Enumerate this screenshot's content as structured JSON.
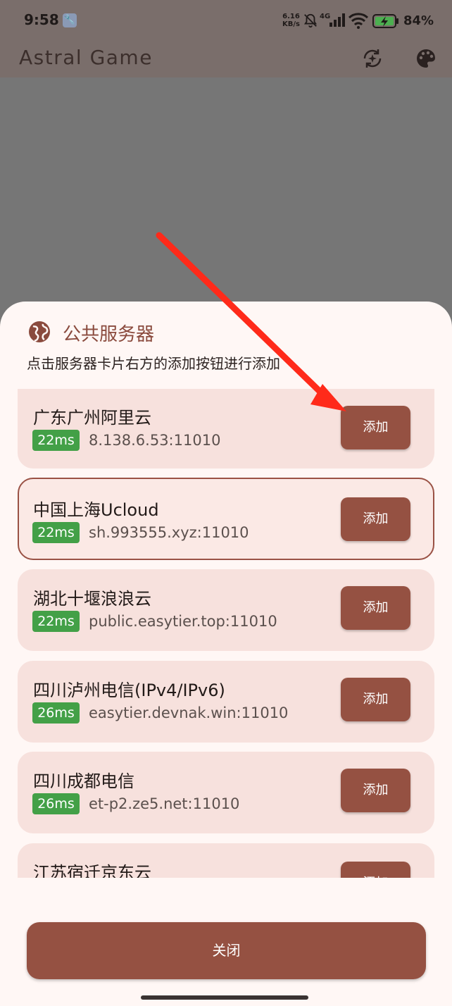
{
  "status_bar": {
    "time": "9:58",
    "net_speed_value": "6.16",
    "net_speed_unit": "KB/s",
    "battery": "84%",
    "icons": [
      "wrench-icon",
      "bell-off-icon",
      "signal-4g-icon",
      "wifi-icon",
      "battery-charging-icon"
    ]
  },
  "app_bar": {
    "title": "Astral Game",
    "icons": [
      "sync-sparkle-icon",
      "palette-icon"
    ]
  },
  "sheet": {
    "title": "公共服务器",
    "subtitle": "点击服务器卡片右方的添加按钮进行添加",
    "header_icon": "globe-icon",
    "servers": [
      {
        "name": "广东广州阿里云",
        "latency": "22ms",
        "address": "8.138.6.53:11010",
        "add_label": "添加"
      },
      {
        "name": "中国上海Ucloud",
        "latency": "22ms",
        "address": "sh.993555.xyz:11010",
        "add_label": "添加",
        "selected": true
      },
      {
        "name": "湖北十堰浪浪云",
        "latency": "22ms",
        "address": "public.easytier.top:11010",
        "add_label": "添加"
      },
      {
        "name": "四川泸州电信(IPv4/IPv6)",
        "latency": "26ms",
        "address": "easytier.devnak.win:11010",
        "add_label": "添加"
      },
      {
        "name": "四川成都电信",
        "latency": "26ms",
        "address": "et-p2.ze5.net:11010",
        "add_label": "添加"
      },
      {
        "name": "江苏宿迁京东云",
        "latency": "",
        "address": "",
        "add_label": "添加"
      }
    ],
    "close_label": "关闭"
  },
  "colors": {
    "primary": "#955142",
    "card_bg": "#f7e1dd",
    "latency_badge": "#43a047",
    "sheet_bg": "#fff7f5",
    "scrim": "#767676",
    "annotation": "#ff2a1a"
  }
}
